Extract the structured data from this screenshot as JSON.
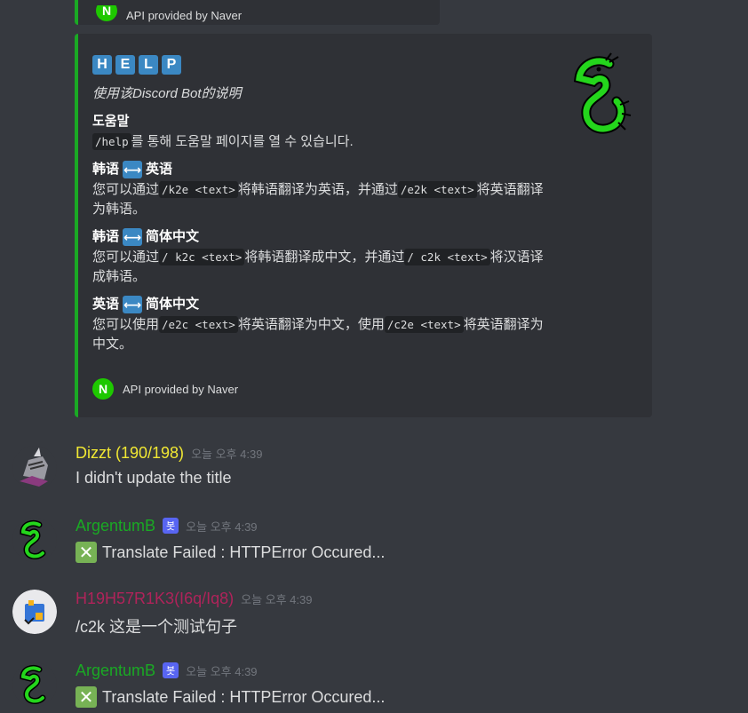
{
  "top_embed": {
    "footer": "API provided by Naver"
  },
  "help_embed": {
    "tiles": [
      "H",
      "E",
      "L",
      "P"
    ],
    "description": "使用该Discord Bot的说明",
    "fields": [
      {
        "name": "도움말",
        "parts": [
          {
            "code": "/help"
          },
          {
            "text": "를 통해 도움말 페이지를 열 수 있습니다."
          }
        ]
      },
      {
        "name_a": "韩语",
        "arrow": "⟷",
        "name_b": "英语",
        "parts": [
          {
            "text": "您可以通过"
          },
          {
            "code": "/k2e <text>"
          },
          {
            "text": "将韩语翻译为英语，并通过"
          },
          {
            "code": "/e2k <text>"
          },
          {
            "text": "将英语翻译为韩语。"
          }
        ]
      },
      {
        "name_a": "韩语",
        "arrow": "⟷",
        "name_b": "简体中文",
        "parts": [
          {
            "text": "您可以通过"
          },
          {
            "code": "/ k2c <text>"
          },
          {
            "text": "将韩语翻译成中文，并通过"
          },
          {
            "code": "/ c2k <text>"
          },
          {
            "text": "将汉语译成韩语。"
          }
        ]
      },
      {
        "name_a": "英语",
        "arrow": "⟷",
        "name_b": "简体中文",
        "parts": [
          {
            "text": "您可以使用"
          },
          {
            "code": "/e2c <text>"
          },
          {
            "text": "将英语翻译为中文，使用"
          },
          {
            "code": "/c2e <text>"
          },
          {
            "text": "将英语翻译为中文。"
          }
        ]
      }
    ],
    "footer_icon": "N",
    "footer": "API provided by Naver",
    "thumbnail_icon": "green-dragon-icon"
  },
  "messages": [
    {
      "username": "Dizzt (190/198)",
      "color": "#f1e833",
      "timestamp": "오늘 오후 4:39",
      "text": "I didn't update the title",
      "avatar_icon": "knight-avatar-icon"
    },
    {
      "username": "ArgentumB",
      "color": "#1aa924",
      "bot_tag": "봇",
      "timestamp": "오늘 오후 4:39",
      "status_icon": "✕",
      "text": "Translate Failed : HTTPError Occured...",
      "avatar_icon": "green-dragon-icon"
    },
    {
      "username": "H19H57R1K3(I6q/Iq8)",
      "color": "#b0235a",
      "timestamp": "오늘 오후 4:39",
      "text": "/c2k 这是一个测试句子",
      "avatar_icon": "puzzle-avatar-icon"
    },
    {
      "username": "ArgentumB",
      "color": "#1aa924",
      "bot_tag": "봇",
      "timestamp": "오늘 오후 4:39",
      "status_icon": "✕",
      "text": "Translate Failed : HTTPError Occured...",
      "avatar_icon": "green-dragon-icon"
    }
  ]
}
